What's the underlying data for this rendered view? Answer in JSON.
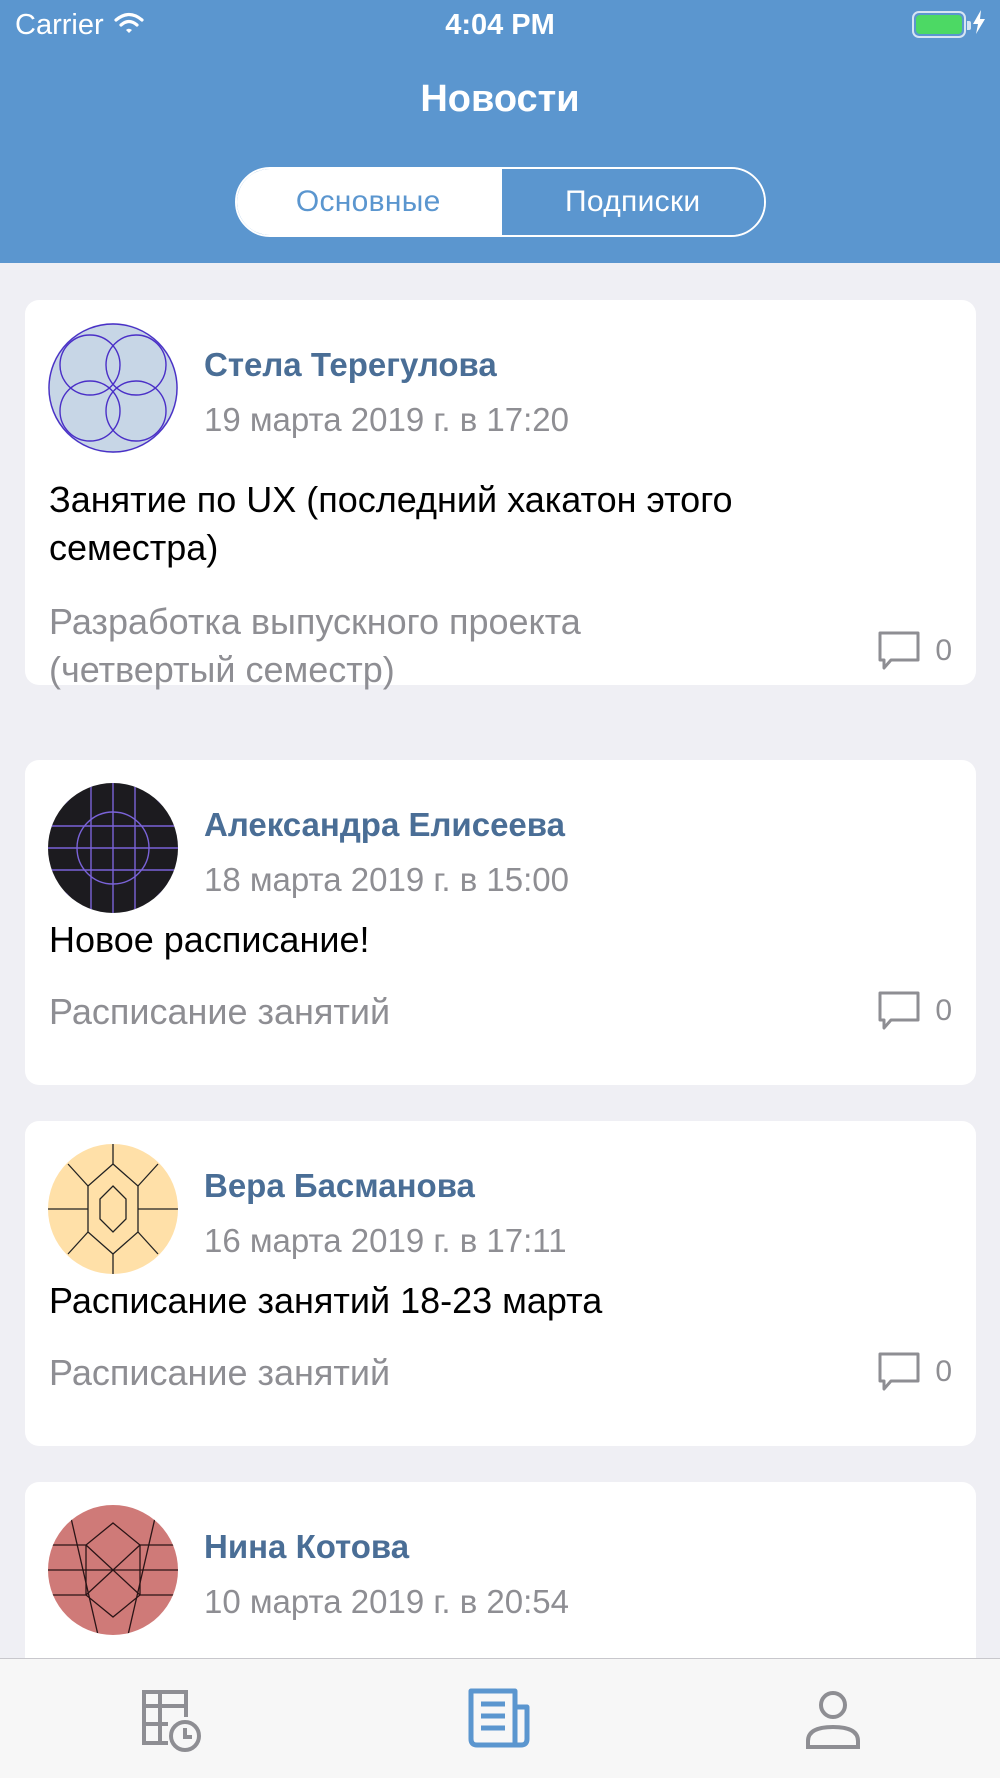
{
  "status_bar": {
    "carrier": "Carrier",
    "time": "4:04 PM",
    "battery_level": 1.0
  },
  "header": {
    "title": "Новости",
    "segments": [
      "Основные",
      "Подписки"
    ],
    "selected_segment": "Основные"
  },
  "colors": {
    "accent": "#5b96cf",
    "author": "#4a6e96",
    "secondary_text": "#8e8e93",
    "background": "#efeff4"
  },
  "posts": [
    {
      "author": "Стела Терегулова",
      "date": "19 марта 2019 г. в 17:20",
      "title": "Занятие по UX (последний хакатон этого семестра)",
      "subtitle": "Разработка выпускного проекта (четвертый семестр)",
      "comments": "0"
    },
    {
      "author": "Александра Елисеева",
      "date": "18 марта 2019 г. в 15:00",
      "title": "Новое расписание!",
      "subtitle": "Расписание занятий",
      "comments": "0"
    },
    {
      "author": "Вера Басманова",
      "date": "16 марта 2019 г. в 17:11",
      "title": "Расписание занятий 18-23 марта",
      "subtitle": "Расписание занятий",
      "comments": "0"
    },
    {
      "author": "Нина Котова",
      "date": "10 марта 2019 г. в 20:54",
      "title": "",
      "subtitle": "",
      "comments": ""
    }
  ],
  "tabbar": {
    "items": [
      "schedule-icon",
      "news-icon",
      "profile-icon"
    ],
    "selected": "news-icon"
  }
}
